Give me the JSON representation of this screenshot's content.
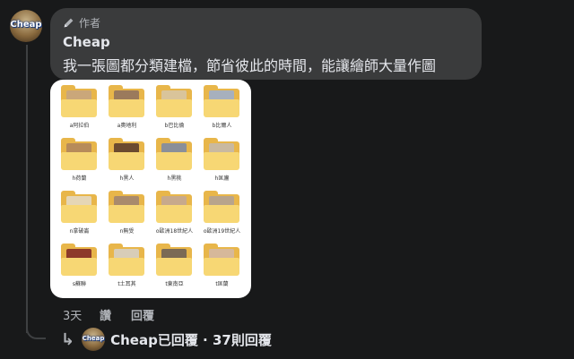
{
  "comment": {
    "author_badge": "作者",
    "author_name": "Cheap",
    "text": "我一張圖都分類建檔，節省彼此的時間，能讓繪師大量作圖",
    "avatar_text": "Cheap"
  },
  "attachment": {
    "folders": [
      {
        "label": "a阿拉伯",
        "pic": "#caa77a"
      },
      {
        "label": "a奧地利",
        "pic": "#9b7a5c"
      },
      {
        "label": "b巴比倫",
        "pic": "#d9c49a"
      },
      {
        "label": "b比爾人",
        "pic": "#a7b0bd"
      },
      {
        "label": "h荷蘭",
        "pic": "#b78b5a"
      },
      {
        "label": "h黑人",
        "pic": "#6b4a2f"
      },
      {
        "label": "h黑桃",
        "pic": "#8a8f99"
      },
      {
        "label": "h匡廬",
        "pic": "#c9b9a0"
      },
      {
        "label": "n拿破崙",
        "pic": "#e5d6b6"
      },
      {
        "label": "n無受",
        "pic": "#a98a6c"
      },
      {
        "label": "o歐洲18世紀人",
        "pic": "#c7a98c"
      },
      {
        "label": "o歐洲19世紀人",
        "pic": "#b8a48c"
      },
      {
        "label": "s蘇聯",
        "pic": "#8d3a2a"
      },
      {
        "label": "t土耳其",
        "pic": "#d8cdb8"
      },
      {
        "label": "t東南亞",
        "pic": "#7b6a55"
      },
      {
        "label": "t匡蘭",
        "pic": "#d6b89a"
      }
    ]
  },
  "actions": {
    "time": "3天",
    "like_label": "讚",
    "reply_label": "回覆"
  },
  "replies": {
    "summary": "Cheap已回覆 · 37則回覆",
    "avatar_text": "Cheap"
  }
}
